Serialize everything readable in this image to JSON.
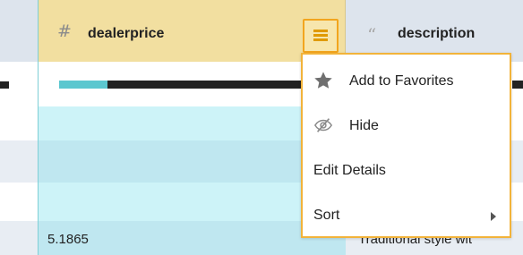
{
  "header": {
    "active_column": {
      "type_icon": "hash-icon",
      "type_glyph": "#",
      "title": "dealerprice"
    },
    "next_column": {
      "type_icon": "quote-icon",
      "type_glyph": "“",
      "title": "description"
    }
  },
  "distribution_bar": {
    "fill_fraction": 0.2
  },
  "rows": {
    "last": {
      "dealerprice": "5.1865",
      "description": "Traditional style wit"
    }
  },
  "menu": {
    "items": [
      {
        "icon": "star-icon",
        "label": "Add to Favorites"
      },
      {
        "icon": "eye-slash-icon",
        "label": "Hide"
      },
      {
        "icon": "",
        "label": "Edit Details"
      },
      {
        "icon": "chevron-right-icon",
        "label": "Sort"
      }
    ]
  },
  "colors": {
    "header_bg": "#dde4ed",
    "active_header_bg": "#f2dfa0",
    "accent_orange": "#f2a51e",
    "teal": "#5bc7cf"
  }
}
